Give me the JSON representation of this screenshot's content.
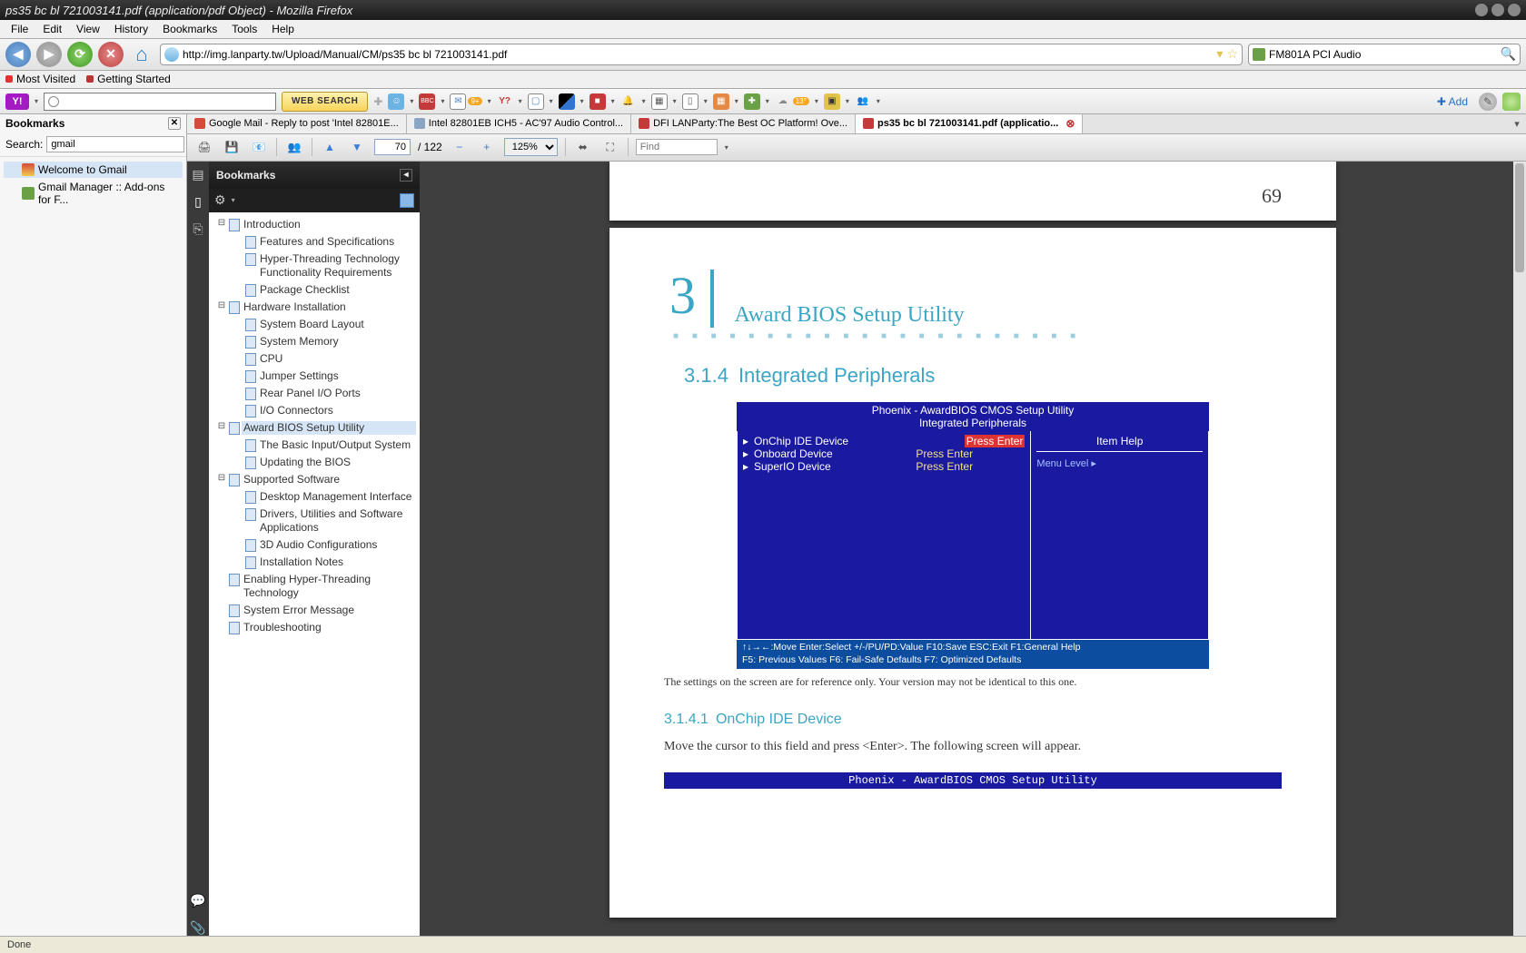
{
  "window": {
    "title": "ps35 bc bl 721003141.pdf (application/pdf Object) - Mozilla Firefox"
  },
  "menus": [
    "File",
    "Edit",
    "View",
    "History",
    "Bookmarks",
    "Tools",
    "Help"
  ],
  "url": "http://img.lanparty.tw/Upload/Manual/CM/ps35 bc bl 721003141.pdf",
  "search_engine": "FM801A PCI Audio",
  "bookmark_links": [
    {
      "label": "Most Visited"
    },
    {
      "label": "Getting Started"
    }
  ],
  "yahoo": {
    "websearch_label": "WEB SEARCH",
    "add_label": "Add"
  },
  "ff_sidebar": {
    "title": "Bookmarks",
    "search_label": "Search:",
    "search_value": "gmail",
    "items": [
      {
        "label": "Welcome to Gmail",
        "selected": true
      },
      {
        "label": "Gmail Manager :: Add-ons for F..."
      }
    ]
  },
  "tabs": [
    {
      "label": "Google Mail - Reply to post 'Intel 82801E...",
      "active": false,
      "favcolor": "#d64a3a"
    },
    {
      "label": "Intel 82801EB ICH5 - AC'97 Audio Control...",
      "active": false,
      "favcolor": "#8aa6c4"
    },
    {
      "label": "DFI LANParty:The Best OC Platform! Ove...",
      "active": false,
      "favcolor": "#c43a3a"
    },
    {
      "label": "ps35 bc bl 721003141.pdf (applicatio...",
      "active": true,
      "favcolor": "#c43a3a",
      "closeable": true
    }
  ],
  "pdfbar": {
    "page": "70",
    "pages": "122",
    "zoom": "125%",
    "find_placeholder": "Find"
  },
  "pdf_bm_title": "Bookmarks",
  "pdf_outline": [
    {
      "label": "Introduction",
      "depth": 0,
      "expand": "-"
    },
    {
      "label": "Features and Specifications",
      "depth": 1
    },
    {
      "label": "Hyper-Threading Technology Functionality Requirements",
      "depth": 1
    },
    {
      "label": "Package Checklist",
      "depth": 1
    },
    {
      "label": "Hardware Installation",
      "depth": 0,
      "expand": "-"
    },
    {
      "label": "System Board Layout",
      "depth": 1
    },
    {
      "label": "System Memory",
      "depth": 1
    },
    {
      "label": "CPU",
      "depth": 1
    },
    {
      "label": "Jumper Settings",
      "depth": 1
    },
    {
      "label": "Rear Panel I/O Ports",
      "depth": 1
    },
    {
      "label": "I/O Connectors",
      "depth": 1
    },
    {
      "label": "Award BIOS Setup Utility",
      "depth": 0,
      "expand": "-",
      "selected": true
    },
    {
      "label": "The Basic Input/Output System",
      "depth": 1
    },
    {
      "label": "Updating the BIOS",
      "depth": 1
    },
    {
      "label": "Supported Software",
      "depth": 0,
      "expand": "-"
    },
    {
      "label": "Desktop Management Interface",
      "depth": 1
    },
    {
      "label": "Drivers, Utilities and Software Applications",
      "depth": 1
    },
    {
      "label": "3D Audio Configurations",
      "depth": 1
    },
    {
      "label": "Installation Notes",
      "depth": 1
    },
    {
      "label": "Enabling Hyper-Threading Technology",
      "depth": 0
    },
    {
      "label": "System Error Message",
      "depth": 0
    },
    {
      "label": "Troubleshooting",
      "depth": 0
    }
  ],
  "page69_num": "69",
  "doc": {
    "chapter_num": "3",
    "chapter_title": "Award BIOS Setup Utility",
    "section_num": "3.1.4",
    "section_title": "Integrated Peripherals",
    "bios_header1": "Phoenix - AwardBIOS CMOS Setup Utility",
    "bios_header2": "Integrated Peripherals",
    "bios_items": [
      {
        "k": "OnChip IDE Device",
        "v": "Press Enter",
        "sel": true
      },
      {
        "k": "Onboard Device",
        "v": "Press Enter"
      },
      {
        "k": "SuperIO Device",
        "v": "Press Enter"
      }
    ],
    "item_help": "Item Help",
    "menu_level": "Menu Level    ▸",
    "bios_footer1": "↑↓→←:Move  Enter:Select  +/-/PU/PD:Value  F10:Save  ESC:Exit  F1:General Help",
    "bios_footer2": "F5: Previous Values    F6: Fail-Safe Defaults    F7: Optimized Defaults",
    "fig_note": "The settings on the screen are for reference only. Your version may not be identical to this one.",
    "subsection_num": "3.1.4.1",
    "subsection_title": "OnChip IDE Device",
    "body": "Move the cursor to this field and press <Enter>. The following screen will appear.",
    "bios2_header": "Phoenix - AwardBIOS CMOS Setup Utility"
  },
  "status": "Done"
}
